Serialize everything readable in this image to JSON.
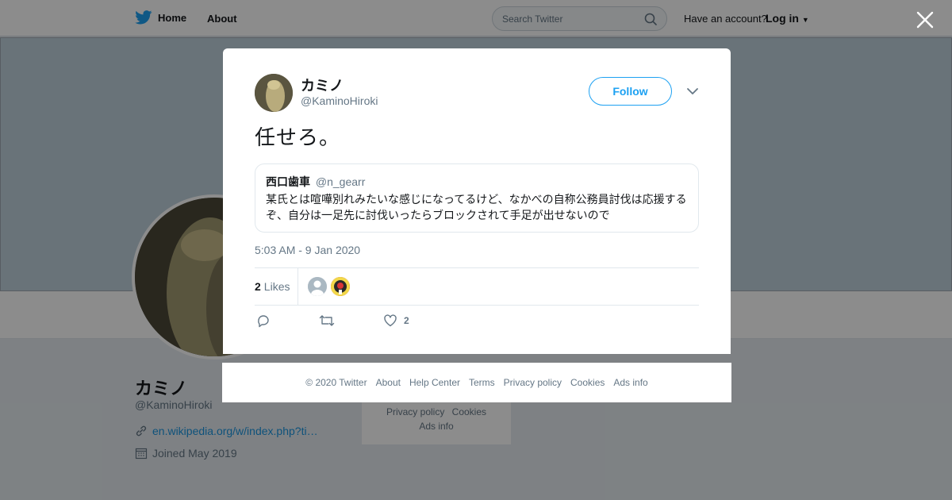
{
  "topbar": {
    "home_label": "Home",
    "about_label": "About",
    "search_placeholder": "Search Twitter",
    "account_prompt": "Have an account?",
    "login_label": "Log in"
  },
  "profile": {
    "name": "カミノ",
    "handle": "@KaminoHiroki",
    "link": "en.wikipedia.org/w/index.php?ti…",
    "joined": "Joined May 2019"
  },
  "side_footer": {
    "privacy": "Privacy policy",
    "cookies": "Cookies",
    "ads": "Ads info"
  },
  "tweet": {
    "author_name": "カミノ",
    "author_handle": "@KaminoHiroki",
    "follow_label": "Follow",
    "text": "任せろ。",
    "quote": {
      "name": "西口歯車",
      "handle": "@n_gearr",
      "text": "某氏とは喧嘩別れみたいな感じになってるけど、なかべの自称公務員討伐は応援するぞ、自分は一足先に討伐いったらブロックされて手足が出せないので"
    },
    "timestamp": "5:03 AM - 9 Jan 2020",
    "likes_count": "2",
    "likes_label": "Likes",
    "like_action_count": "2"
  },
  "modal_footer": {
    "copyright": "© 2020 Twitter",
    "about": "About",
    "help": "Help Center",
    "terms": "Terms",
    "privacy": "Privacy policy",
    "cookies": "Cookies",
    "ads": "Ads info"
  },
  "colors": {
    "accent": "#1da1f2",
    "text_secondary": "#657786"
  }
}
